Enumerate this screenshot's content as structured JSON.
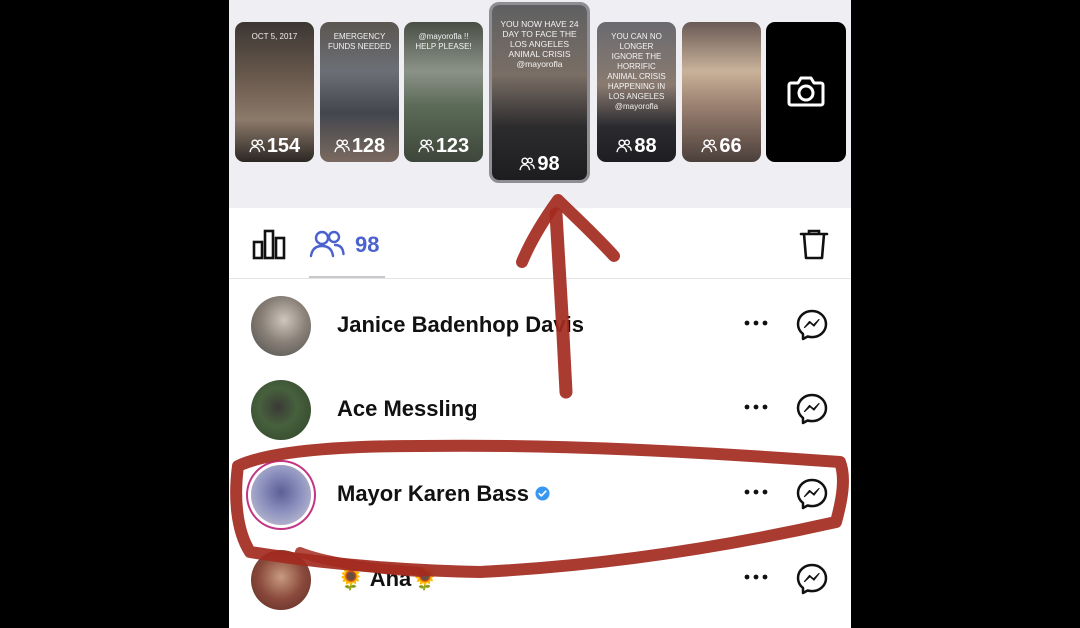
{
  "stories": [
    {
      "count": "154",
      "caption": "OCT 5, 2017",
      "bg": "linear-gradient(180deg,#3b3632 0%,#6a5a4e 40%,#8c7a6a 70%,#2b2724 100%)"
    },
    {
      "count": "128",
      "caption": "EMERGENCY FUNDS NEEDED",
      "bg": "linear-gradient(180deg,#5b5650 0%,#6c6f76 35%,#43464d 65%,#7a6a60 100%)"
    },
    {
      "count": "123",
      "caption": "@mayorofla !! HELP PLEASE!",
      "bg": "linear-gradient(180deg,#4a4f45 0%,#8b9288 35%,#5c6b58 60%,#3d463a 100%)"
    },
    {
      "count": "98",
      "caption": "YOU NOW HAVE 24 DAY TO FACE THE LOS ANGELES ANIMAL CRISIS @mayorofla",
      "bg": "linear-gradient(180deg,#5f6062 0%,#7a6e65 40%,#2c2b2d 70%,#1d1c1e 100%)",
      "selected": true
    },
    {
      "count": "88",
      "caption": "YOU CAN NO LONGER IGNORE THE HORRIFIC ANIMAL CRISIS HAPPENING IN LOS ANGELES @mayorofla",
      "bg": "linear-gradient(180deg,#6a6a70 0%,#8a7b70 45%,#2a2a2f 75%,#1e1e22 100%)"
    },
    {
      "count": "66",
      "caption": "",
      "bg": "linear-gradient(180deg,#6a5a55 0%,#c9b29a 35%,#9a8070 60%,#4b3f3b 100%)"
    }
  ],
  "toolbar": {
    "viewer_count": "98"
  },
  "viewers": [
    {
      "name": "Janice Badenhop Davis",
      "avatar_bg": "radial-gradient(circle at 55% 40%,#cfc7bd 0%,#8a8178 45%,#4a4a4a 100%)",
      "verified": false,
      "ring": false
    },
    {
      "name": "Ace Messling",
      "avatar_bg": "radial-gradient(circle at 45% 45%,#3a3a36 0%,#47603d 40%,#2e4428 100%)",
      "verified": false,
      "ring": false
    },
    {
      "name": "Mayor Karen Bass",
      "avatar_bg": "radial-gradient(circle at 50% 45%,#5b5f95 0%,#8c91bf 45%,#d0cdd6 100%)",
      "verified": true,
      "ring": true
    },
    {
      "name": "🌻 Ana🌻",
      "avatar_bg": "radial-gradient(circle at 50% 45%,#c89b80 0%,#8a4a3c 50%,#5b2a25 100%)",
      "verified": false,
      "ring": false
    }
  ],
  "colors": {
    "accent": "#4a61ce",
    "verified": "#3897f0",
    "annotation": "#a32a1f"
  }
}
